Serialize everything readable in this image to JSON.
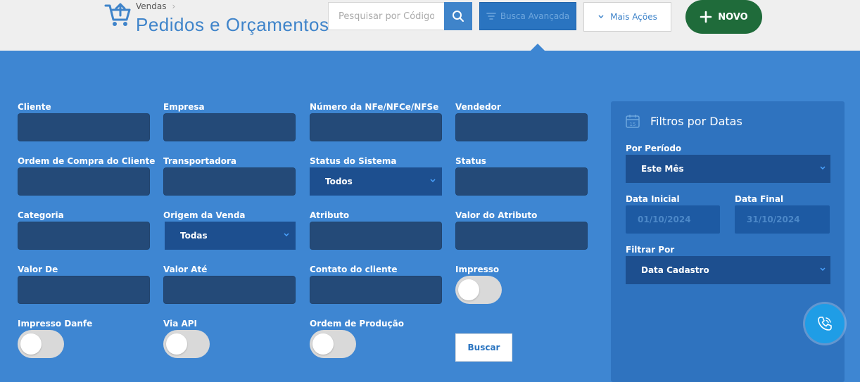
{
  "header": {
    "breadcrumb": "Vendas",
    "title": "Pedidos e Orçamentos",
    "search_placeholder": "Pesquisar por Código do",
    "advanced_search_label": "Busca Avançada",
    "more_actions_label": "Mais Ações",
    "new_label": "NOVO"
  },
  "filters": {
    "cliente": {
      "label": "Cliente",
      "value": ""
    },
    "empresa": {
      "label": "Empresa",
      "value": ""
    },
    "numero_nfe": {
      "label": "Número da NFe/NFCe/NFSe",
      "value": ""
    },
    "vendedor": {
      "label": "Vendedor",
      "value": ""
    },
    "ordem_compra": {
      "label": "Ordem de Compra do Cliente",
      "value": ""
    },
    "transportadora": {
      "label": "Transportadora",
      "value": ""
    },
    "status_sistema": {
      "label": "Status do Sistema",
      "value": "Todos"
    },
    "status": {
      "label": "Status",
      "value": ""
    },
    "categoria": {
      "label": "Categoria",
      "value": ""
    },
    "origem_venda": {
      "label": "Origem da Venda",
      "value": "Todas"
    },
    "atributo": {
      "label": "Atributo",
      "value": ""
    },
    "valor_atributo": {
      "label": "Valor do Atributo",
      "value": ""
    },
    "valor_de": {
      "label": "Valor De",
      "value": ""
    },
    "valor_ate": {
      "label": "Valor Até",
      "value": ""
    },
    "contato_cliente": {
      "label": "Contato do cliente",
      "value": ""
    },
    "impresso": {
      "label": "Impresso",
      "on": false
    },
    "impresso_danfe": {
      "label": "Impresso Danfe",
      "on": false
    },
    "via_api": {
      "label": "Via API",
      "on": false
    },
    "ordem_producao": {
      "label": "Ordem de Produção",
      "on": false
    },
    "search_button": "Buscar"
  },
  "date_filters": {
    "title": "Filtros por Datas",
    "periodo_label": "Por Período",
    "periodo_value": "Este Mês",
    "data_inicial_label": "Data Inicial",
    "data_inicial_value": "01/10/2024",
    "data_final_label": "Data Final",
    "data_final_value": "31/10/2024",
    "filtrar_por_label": "Filtrar Por",
    "filtrar_por_value": "Data Cadastro"
  },
  "colors": {
    "panel_bg": "#3e86d2",
    "input_bg": "#244a78",
    "accent": "#3f84ca",
    "new_button": "#1f6b3a"
  },
  "icons": [
    "cart-icon",
    "search-icon",
    "filter-icon",
    "chevron-down-icon",
    "plus-icon",
    "calendar-icon",
    "phone-icon"
  ]
}
